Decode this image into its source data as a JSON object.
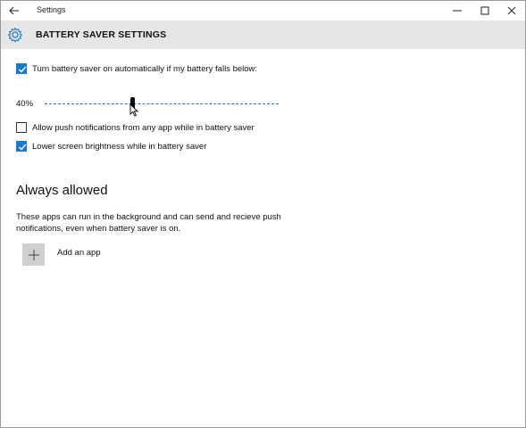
{
  "window": {
    "title": "Settings",
    "back_icon": "arrow-left-icon",
    "minimize_icon": "minimize-icon",
    "maximize_icon": "maximize-icon",
    "close_icon": "close-icon"
  },
  "header": {
    "icon": "gear-icon",
    "title": "BATTERY SAVER SETTINGS"
  },
  "settings": {
    "auto_on": {
      "label": "Turn battery saver on automatically if my battery falls below:",
      "checked": true
    },
    "threshold": {
      "value_label": "40%",
      "value_percent": 40
    },
    "push_notifications": {
      "label": "Allow push notifications from any app while in battery saver",
      "checked": false
    },
    "lower_brightness": {
      "label": "Lower screen brightness while in battery saver",
      "checked": true
    }
  },
  "always_allowed": {
    "heading": "Always allowed",
    "description": "These apps can run in the background and can send and recieve push notifications, even when battery saver is on.",
    "add_button_label": "Add an app",
    "add_icon": "plus-icon"
  },
  "colors": {
    "accent": "#1979ca",
    "header_band": "#e6e6e6"
  }
}
